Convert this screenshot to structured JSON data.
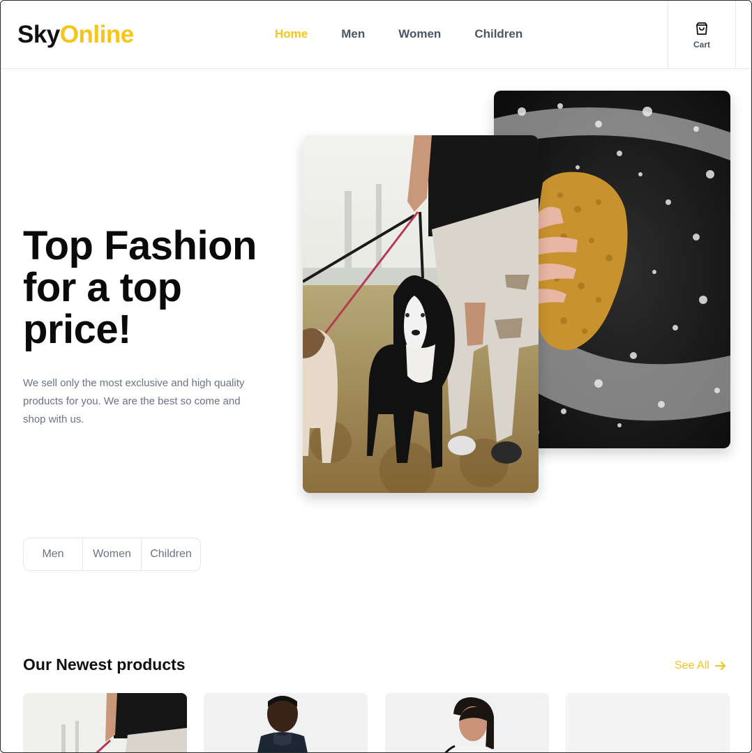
{
  "brand": {
    "part1": "Sky",
    "part2": "Online",
    "accent": "#f5c518"
  },
  "nav": {
    "items": [
      {
        "label": "Home",
        "active": true
      },
      {
        "label": "Men",
        "active": false
      },
      {
        "label": "Women",
        "active": false
      },
      {
        "label": "Children",
        "active": false
      }
    ]
  },
  "cart": {
    "label": "Cart",
    "icon": "shopping-bag-icon"
  },
  "hero": {
    "title": "Top Fashion for a top price!",
    "description": "We sell only the most exclusive and high quality products for you. We are the best so come and shop with us."
  },
  "category_tabs": [
    "Men",
    "Women",
    "Children"
  ],
  "products_section": {
    "title": "Our Newest products",
    "see_all": "See All",
    "see_all_icon": "arrow-right-icon"
  }
}
